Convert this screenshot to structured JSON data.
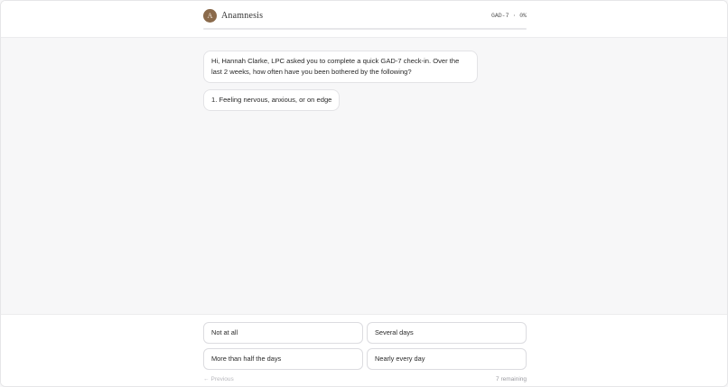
{
  "header": {
    "avatar_letter": "A",
    "brand": "Anamnesis",
    "progress_label": "GAD-7 · 0%",
    "progress_percent": 0,
    "accent_color": "#8a6a4b"
  },
  "chat": {
    "intro": "Hi, Hannah Clarke, LPC asked you to complete a quick GAD-7 check-in. Over the last 2 weeks, how often have you been bothered by the following?",
    "question": "1. Feeling nervous, anxious, or on edge"
  },
  "answers": {
    "options": [
      "Not at all",
      "Several days",
      "More than half the days",
      "Nearly every day"
    ]
  },
  "nav": {
    "previous_arrow": "←",
    "previous_label": "Previous",
    "remaining": "7 remaining"
  }
}
